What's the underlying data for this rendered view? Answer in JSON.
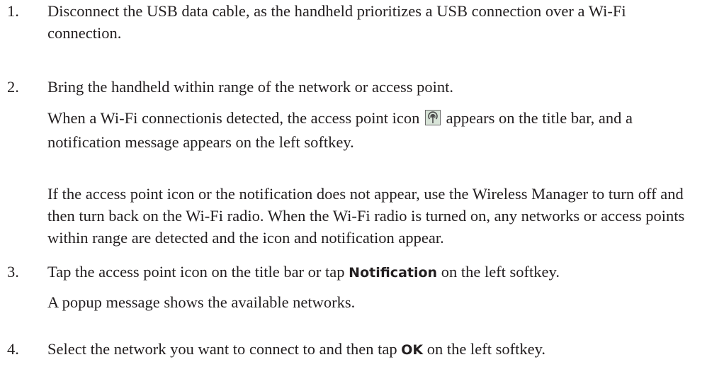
{
  "steps": [
    {
      "number": "1.",
      "text": "Disconnect the USB data cable, as the handheld prioritizes a USB connection over a Wi-Fi connection."
    },
    {
      "number": "2.",
      "text": "Bring the handheld within range of the network or access point.",
      "detail_before_icon": "When a Wi-Fi connectionis detected, the access point icon",
      "detail_after_icon": "appears on the title bar, and a notification message appears on the left softkey.",
      "icon": "access-point-icon",
      "note": "If the access point icon or the notification does not appear, use the Wireless Manager to turn off and then turn back on the Wi-Fi radio. When the Wi-Fi radio is turned on, any networks or access points within range are detected and the icon and notification appear."
    },
    {
      "number": "3.",
      "text_before": "Tap the access point icon on the title bar or tap",
      "bold": "Notification",
      "text_after": "on the left softkey.",
      "detail": "A popup message shows the available networks."
    },
    {
      "number": "4.",
      "text_before": "Select the network you want to connect to and then tap",
      "bold": "OK",
      "text_after": "on the left softkey."
    }
  ],
  "colors": {
    "text": "#231f20",
    "icon_border": "#6a6a6a",
    "icon_fill": "#d8e4d8"
  }
}
